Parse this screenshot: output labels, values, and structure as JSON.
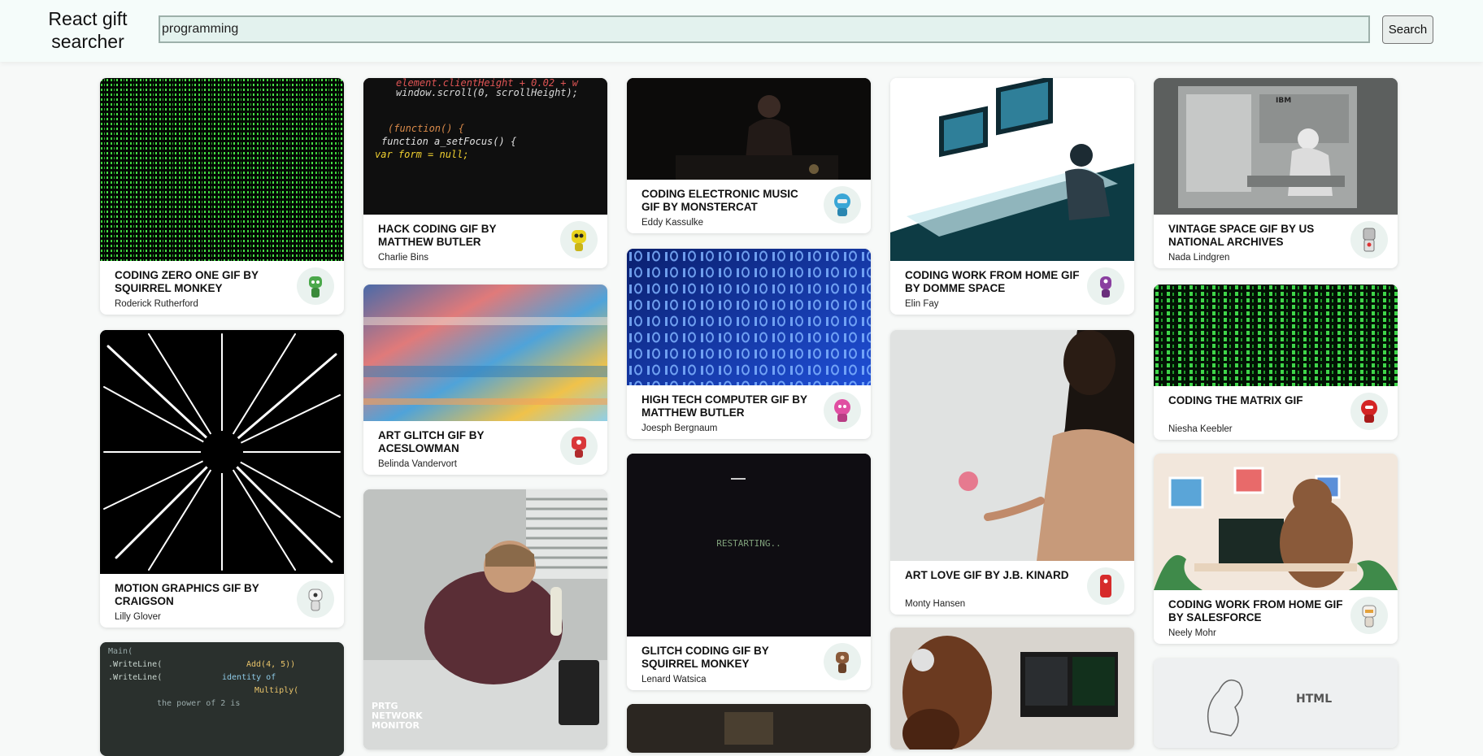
{
  "app": {
    "title": "React gift searcher"
  },
  "search": {
    "value": "programming",
    "button_label": "Search"
  },
  "cards": [
    {
      "title": "CODING ZERO ONE GIF BY SQUIRREL MONKEY",
      "author": "Roderick Rutherford",
      "avatar_icon": "green-robot-icon",
      "avatar_color": "#4aa84a"
    },
    {
      "title": "MOTION GRAPHICS GIF BY CRAIGSON",
      "author": "Lilly Glover",
      "avatar_icon": "white-robot-icon",
      "avatar_color": "#f2f2f2"
    },
    {
      "title": "HACK CODING GIF BY MATTHEW BUTLER",
      "author": "Charlie Bins",
      "avatar_icon": "yellow-robot-icon",
      "avatar_color": "#e8d21c"
    },
    {
      "title": "ART GLITCH GIF BY ACESLOWMAN",
      "author": "Belinda Vandervort",
      "avatar_icon": "red-robot-icon",
      "avatar_color": "#d9383a"
    },
    {
      "title": "CODING ELECTRONIC MUSIC GIF BY MONSTERCAT",
      "author": "Eddy Kassulke",
      "avatar_icon": "blue-robot-icon",
      "avatar_color": "#3aa6d6"
    },
    {
      "title": "HIGH TECH COMPUTER GIF BY MATTHEW BUTLER",
      "author": "Joesph Bergnaum",
      "avatar_icon": "pink-robot-icon",
      "avatar_color": "#e04fa2"
    },
    {
      "title": "GLITCH CODING GIF BY SQUIRREL MONKEY",
      "author": "Lenard Watsica",
      "avatar_icon": "brown-robot-icon",
      "avatar_color": "#8a5a3a"
    },
    {
      "title": "CODING WORK FROM HOME GIF BY DOMME SPACE",
      "author": "Elin Fay",
      "avatar_icon": "purple-robot-icon",
      "avatar_color": "#8a3fa0"
    },
    {
      "title": "ART LOVE GIF BY J.B. KINARD",
      "author": "Monty Hansen",
      "avatar_icon": "red-robot-icon",
      "avatar_color": "#d62b2b"
    },
    {
      "title": "VINTAGE SPACE GIF BY US NATIONAL ARCHIVES",
      "author": "Nada Lindgren",
      "avatar_icon": "grey-robot-icon",
      "avatar_color": "#bdbdbd"
    },
    {
      "title": "CODING THE MATRIX GIF",
      "author": "Niesha Keebler",
      "avatar_icon": "red-robot-icon",
      "avatar_color": "#d42424"
    },
    {
      "title": "CODING WORK FROM HOME GIF BY SALESFORCE",
      "author": "Neely Mohr",
      "avatar_icon": "white-robot-icon",
      "avatar_color": "#e9e4dc"
    }
  ],
  "image_text": {
    "hack_code": [
      "element.clientHeight + 0.02 + w",
      "window.scroll(0, scrollHeight);",
      "(function() {",
      "function a_setFocus() {",
      "var form = null;"
    ],
    "restarting": "RESTARTING..",
    "prtg": [
      "PRTG",
      "NETWORK",
      "MONITOR"
    ],
    "ibm": "IBM",
    "html_badge": "HTML",
    "code_partial": [
      "Main(",
      ".WriteLine(",
      ".WriteLine(",
      "Add(4, 5))",
      "identity of",
      "Multiply(",
      "the power of 2 is"
    ]
  }
}
